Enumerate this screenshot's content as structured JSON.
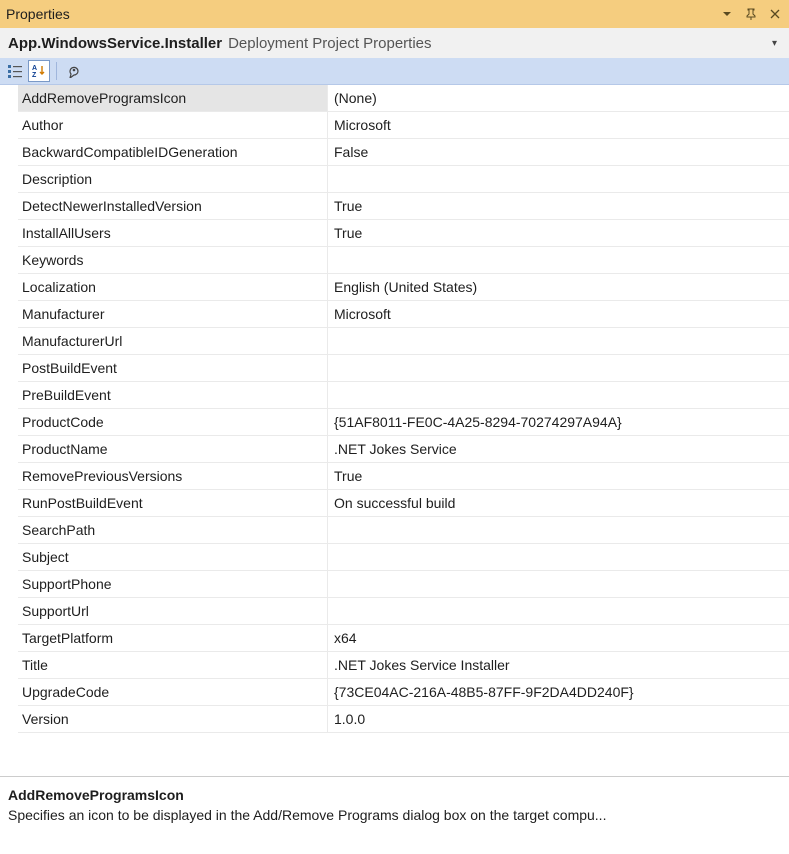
{
  "window": {
    "title": "Properties"
  },
  "header": {
    "title": "App.WindowsService.Installer",
    "subtitle": "Deployment Project Properties"
  },
  "grid": {
    "rows": [
      {
        "name": "AddRemoveProgramsIcon",
        "value": "(None)",
        "selected": true
      },
      {
        "name": "Author",
        "value": "Microsoft"
      },
      {
        "name": "BackwardCompatibleIDGeneration",
        "value": "False"
      },
      {
        "name": "Description",
        "value": ""
      },
      {
        "name": "DetectNewerInstalledVersion",
        "value": "True"
      },
      {
        "name": "InstallAllUsers",
        "value": "True"
      },
      {
        "name": "Keywords",
        "value": ""
      },
      {
        "name": "Localization",
        "value": "English (United States)"
      },
      {
        "name": "Manufacturer",
        "value": "Microsoft"
      },
      {
        "name": "ManufacturerUrl",
        "value": ""
      },
      {
        "name": "PostBuildEvent",
        "value": ""
      },
      {
        "name": "PreBuildEvent",
        "value": ""
      },
      {
        "name": "ProductCode",
        "value": "{51AF8011-FE0C-4A25-8294-70274297A94A}"
      },
      {
        "name": "ProductName",
        "value": ".NET Jokes Service"
      },
      {
        "name": "RemovePreviousVersions",
        "value": "True"
      },
      {
        "name": "RunPostBuildEvent",
        "value": "On successful build"
      },
      {
        "name": "SearchPath",
        "value": ""
      },
      {
        "name": "Subject",
        "value": ""
      },
      {
        "name": "SupportPhone",
        "value": ""
      },
      {
        "name": "SupportUrl",
        "value": ""
      },
      {
        "name": "TargetPlatform",
        "value": "x64"
      },
      {
        "name": "Title",
        "value": ".NET Jokes Service Installer"
      },
      {
        "name": "UpgradeCode",
        "value": "{73CE04AC-216A-48B5-87FF-9F2DA4DD240F}"
      },
      {
        "name": "Version",
        "value": "1.0.0"
      }
    ]
  },
  "description": {
    "title": "AddRemoveProgramsIcon",
    "text": "Specifies an icon to be displayed in the Add/Remove Programs dialog box on the target compu..."
  }
}
